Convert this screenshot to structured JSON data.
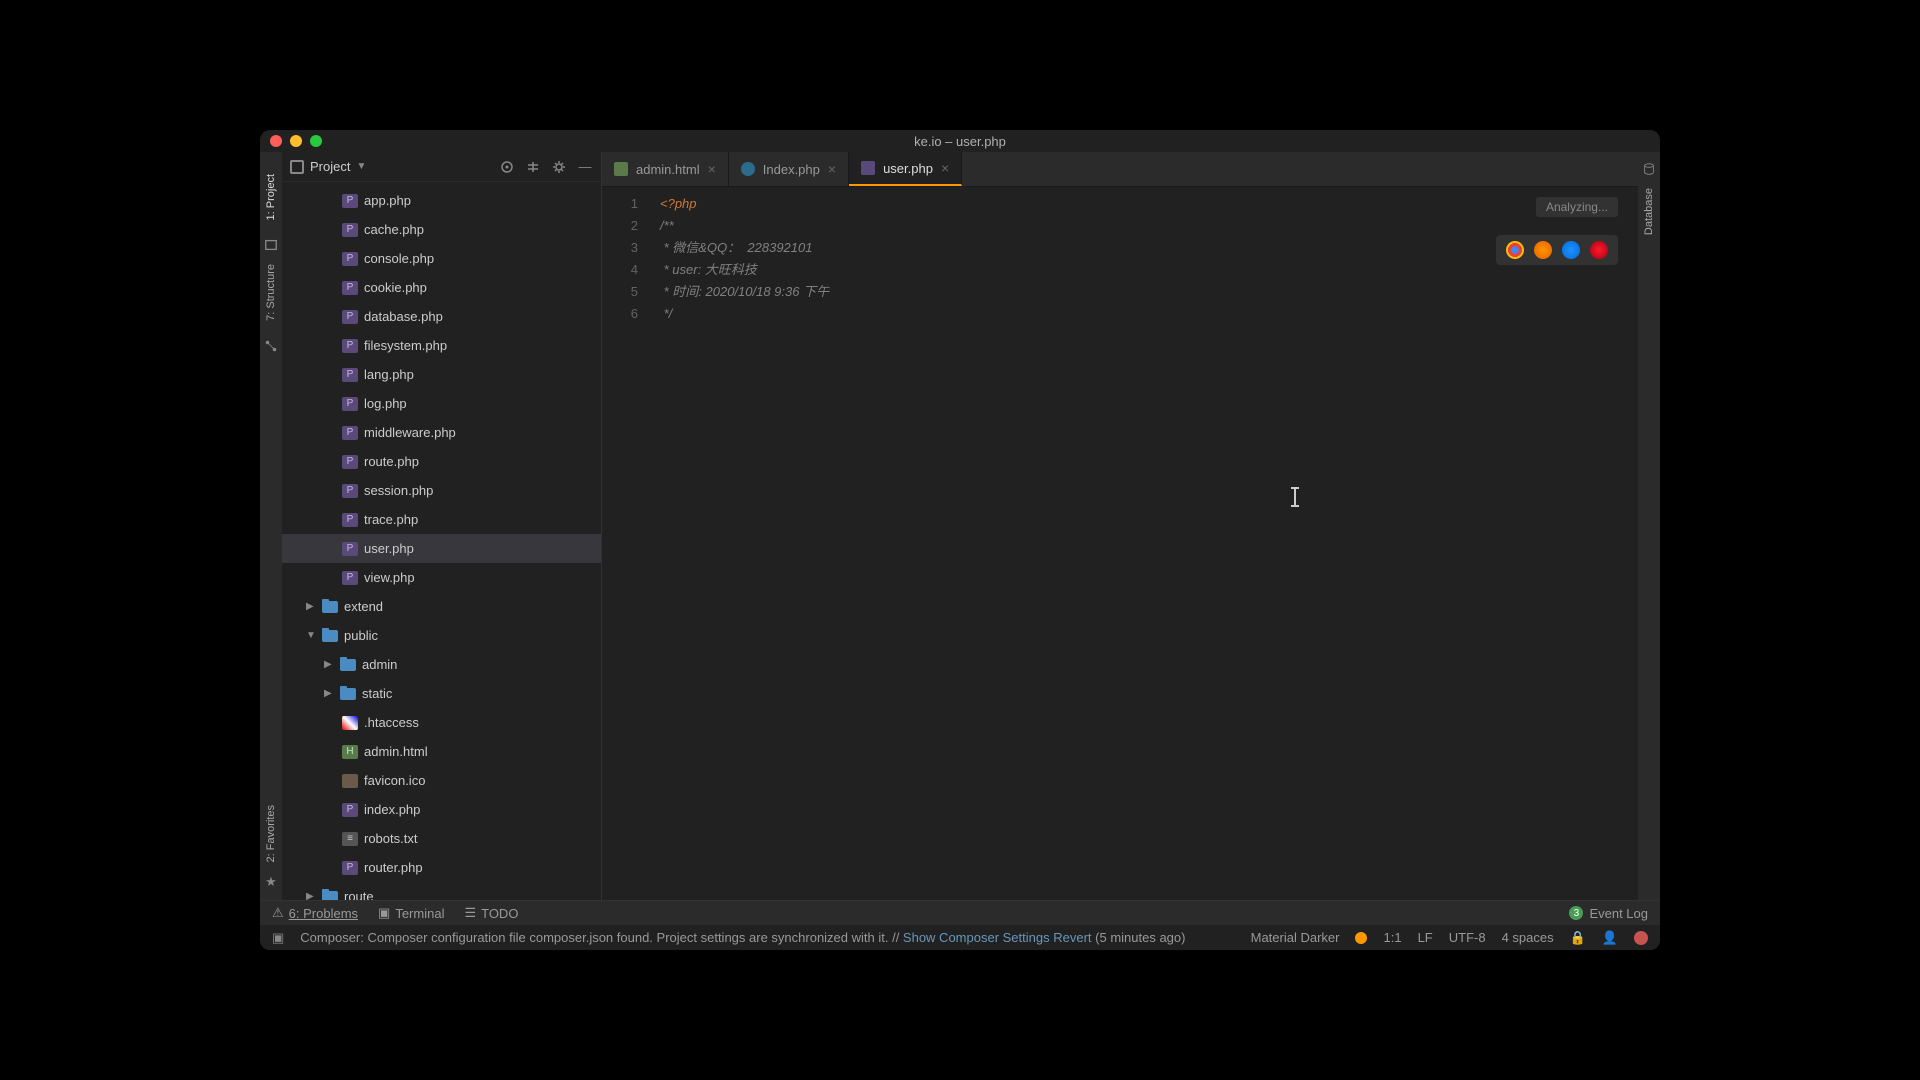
{
  "window": {
    "title": "ke.io – user.php"
  },
  "left_tabs": {
    "project": "1: Project",
    "structure": "7: Structure",
    "favorites": "2: Favorites"
  },
  "sidebar": {
    "title": "Project",
    "files_top": [
      "app.php",
      "cache.php",
      "console.php",
      "cookie.php",
      "database.php",
      "filesystem.php",
      "lang.php",
      "log.php",
      "middleware.php",
      "route.php",
      "session.php",
      "trace.php",
      "user.php",
      "view.php"
    ],
    "folders": [
      {
        "name": "extend",
        "open": false,
        "indent": 1
      },
      {
        "name": "public",
        "open": true,
        "indent": 1
      },
      {
        "name": "admin",
        "open": false,
        "indent": 2
      },
      {
        "name": "static",
        "open": false,
        "indent": 2
      }
    ],
    "files_public": [
      {
        "name": ".htaccess",
        "type": "htaccess"
      },
      {
        "name": "admin.html",
        "type": "html"
      },
      {
        "name": "favicon.ico",
        "type": "ico"
      },
      {
        "name": "index.php",
        "type": "php"
      },
      {
        "name": "robots.txt",
        "type": "txt"
      },
      {
        "name": "router.php",
        "type": "php"
      }
    ],
    "folder_route": {
      "name": "route",
      "open": false,
      "indent": 1
    }
  },
  "tabs": [
    {
      "label": "admin.html",
      "type": "html",
      "active": false
    },
    {
      "label": "Index.php",
      "type": "php-circle",
      "active": false
    },
    {
      "label": "user.php",
      "type": "php",
      "active": true
    }
  ],
  "analyzing": "Analyzing...",
  "editor": {
    "lines": [
      "1",
      "2",
      "3",
      "4",
      "5",
      "6"
    ],
    "code": {
      "l1": "<?php",
      "l2": "/**",
      "l3": " * 微信&QQ：  228392101",
      "l4": " * user: 大旺科技",
      "l5": " * 时间: 2020/10/18 9:36 下午",
      "l6": " */"
    }
  },
  "bottom": {
    "problems": "6: Problems",
    "terminal": "Terminal",
    "todo": "TODO",
    "eventlog": "Event Log",
    "event_count": "3"
  },
  "status": {
    "msg_prefix": "Composer: Composer configuration file composer.json found. Project settings are synchronized with it. // ",
    "link1": "Show Composer Settings",
    "sep": "   ",
    "link2": "Revert",
    "time": " (5 minutes ago)",
    "theme": "Material Darker",
    "pos": "1:1",
    "lf": "LF",
    "enc": "UTF-8",
    "indent": "4 spaces"
  },
  "right_tab": "Database"
}
